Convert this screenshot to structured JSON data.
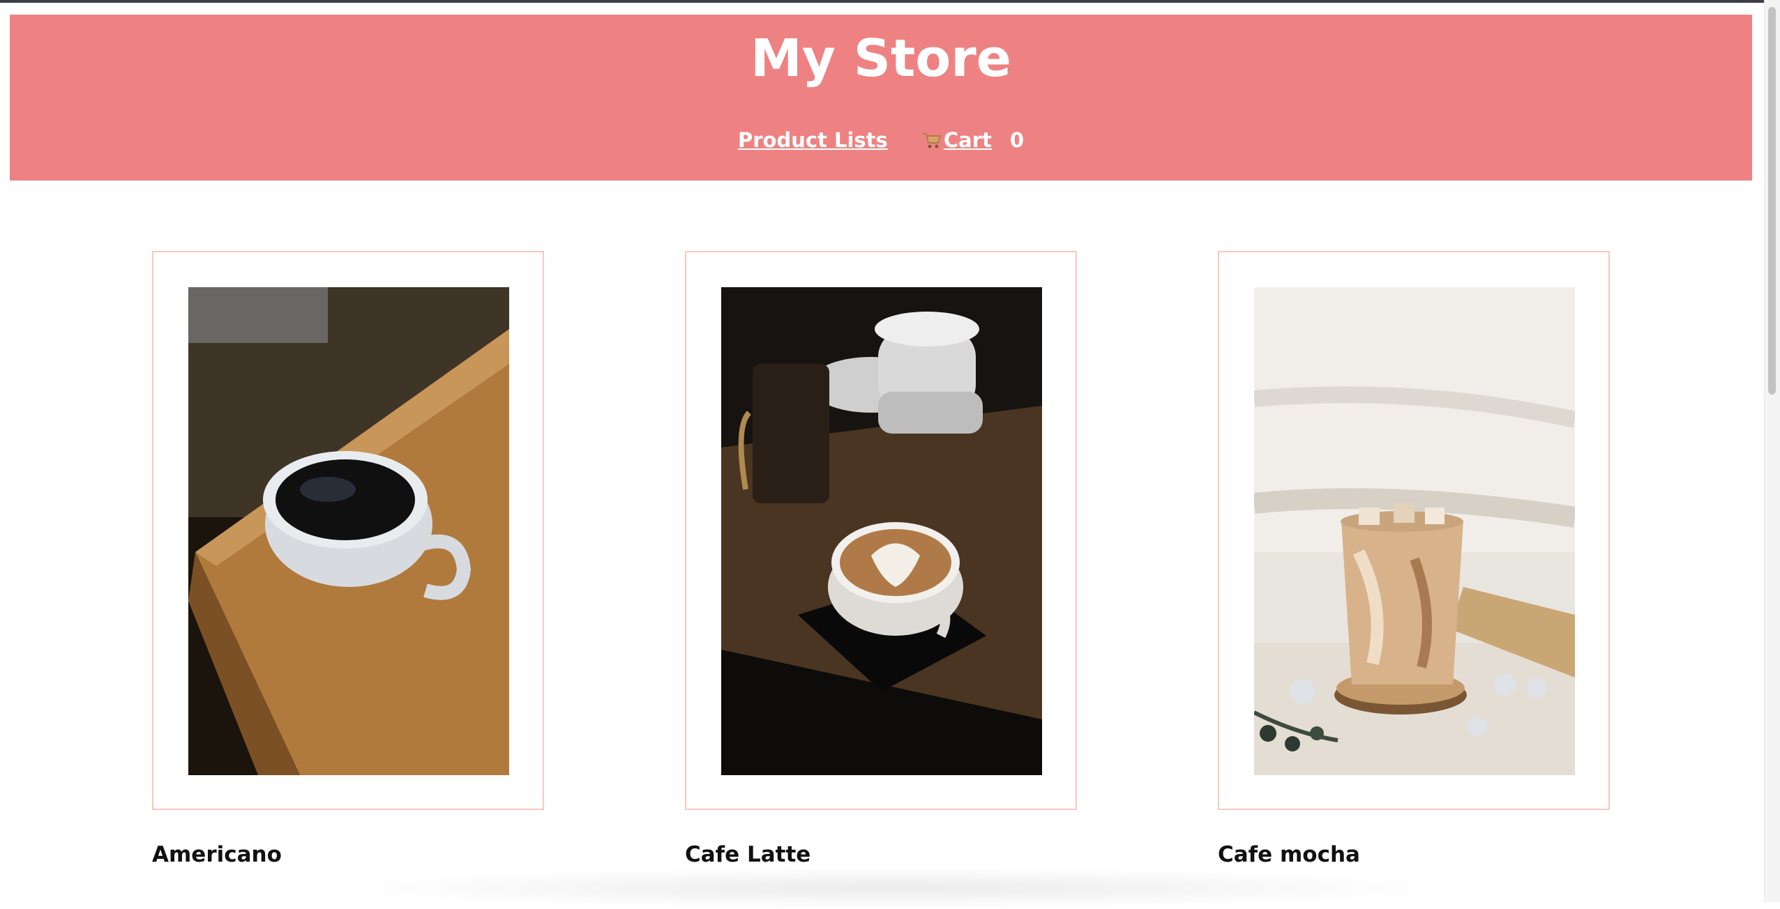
{
  "header": {
    "title": "My Store",
    "nav": {
      "product_lists": "Product Lists",
      "cart": "Cart",
      "cart_count": "0",
      "cart_icon": "shopping-cart-icon"
    },
    "background_color": "#ee8282"
  },
  "products": [
    {
      "name": "Americano",
      "image": "americano-photo"
    },
    {
      "name": "Cafe Latte",
      "image": "cafe-latte-photo"
    },
    {
      "name": "Cafe mocha",
      "image": "cafe-mocha-photo"
    }
  ],
  "colors": {
    "card_border": "#f8c8c0",
    "text": "#111111"
  }
}
